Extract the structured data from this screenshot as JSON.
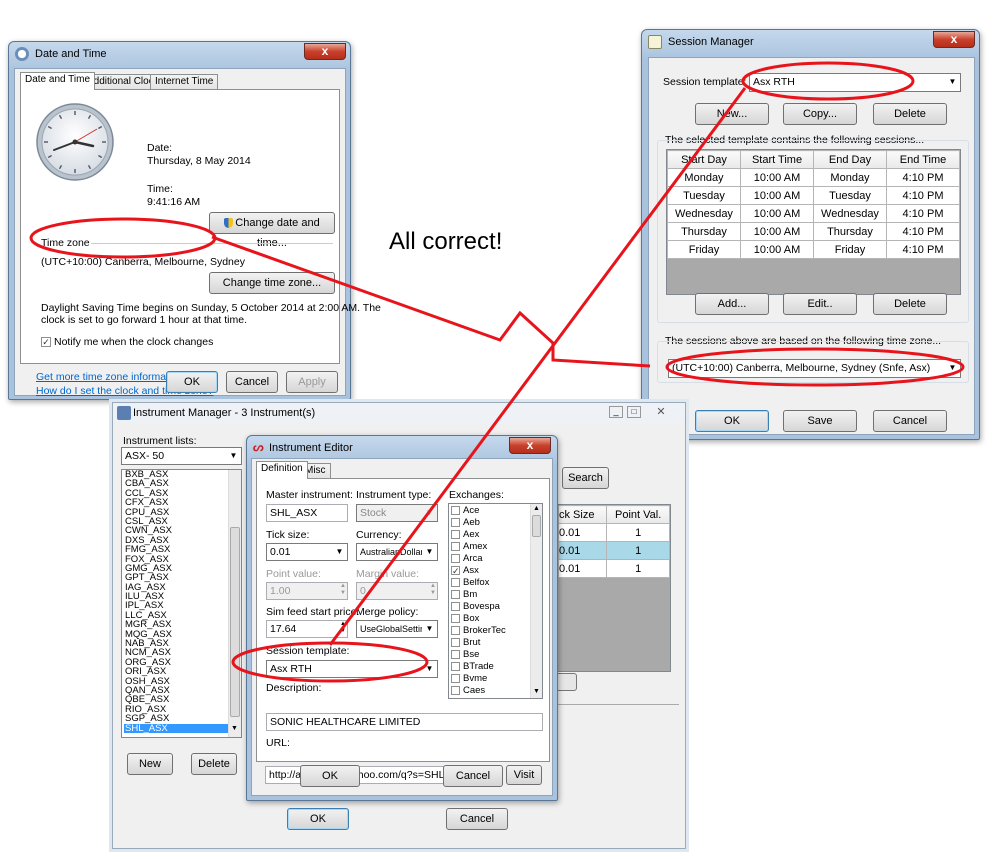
{
  "annotation": {
    "text": "All correct!"
  },
  "datetime": {
    "title": "Date and Time",
    "close": "x",
    "tabs": [
      "Date and Time",
      "Additional Clocks",
      "Internet Time"
    ],
    "date_label": "Date:",
    "date_value": "Thursday, 8 May 2014",
    "time_label": "Time:",
    "time_value": "9:41:16 AM",
    "change_dt_btn": "Change date and time...",
    "tz_label": "Time zone",
    "tz_value": "(UTC+10:00) Canberra, Melbourne, Sydney",
    "change_tz_btn": "Change time zone...",
    "dst_text_1": "Daylight Saving Time begins on Sunday, 5 October 2014 at 2:00 AM. The",
    "dst_text_2": "clock is set to go forward 1 hour at that time.",
    "notify_label": "Notify me when the clock changes",
    "link1": "Get more time zone information online",
    "link2": "How do I set the clock and time zone?",
    "ok": "OK",
    "cancel": "Cancel",
    "apply": "Apply"
  },
  "session": {
    "title": "Session Manager",
    "close": "x",
    "template_label": "Session template:",
    "template_value": "Asx RTH",
    "new_btn": "New...",
    "copy_btn": "Copy...",
    "delete_btn": "Delete",
    "sessions_caption": "The selected template contains the following sessions...",
    "columns": [
      "Start Day",
      "Start Time",
      "End Day",
      "End Time"
    ],
    "rows": [
      [
        "Monday",
        "10:00 AM",
        "Monday",
        "4:10 PM"
      ],
      [
        "Tuesday",
        "10:00 AM",
        "Tuesday",
        "4:10 PM"
      ],
      [
        "Wednesday",
        "10:00 AM",
        "Wednesday",
        "4:10 PM"
      ],
      [
        "Thursday",
        "10:00 AM",
        "Thursday",
        "4:10 PM"
      ],
      [
        "Friday",
        "10:00 AM",
        "Friday",
        "4:10 PM"
      ]
    ],
    "add_btn": "Add...",
    "edit_btn": "Edit..",
    "delete2_btn": "Delete",
    "tz_caption": "The sessions above are based on the following time zone...",
    "tz_value": "(UTC+10:00) Canberra, Melbourne, Sydney (Snfe, Asx)",
    "ok": "OK",
    "save": "Save",
    "cancel": "Cancel"
  },
  "instmgr": {
    "title": "Instrument Manager - 3 Instrument(s)",
    "lists_label": "Instrument lists:",
    "list_value": "ASX- 50",
    "symbols": [
      "BXB_ASX",
      "CBA_ASX",
      "CCL_ASX",
      "CFX_ASX",
      "CPU_ASX",
      "CSL_ASX",
      "CWN_ASX",
      "DXS_ASX",
      "FMG_ASX",
      "FOX_ASX",
      "GMG_ASX",
      "GPT_ASX",
      "IAG_ASX",
      "ILU_ASX",
      "IPL_ASX",
      "LLC_ASX",
      "MGR_ASX",
      "MQG_ASX",
      "NAB_ASX",
      "NCM_ASX",
      "ORG_ASX",
      "ORI_ASX",
      "OSH_ASX",
      "QAN_ASX",
      "QBE_ASX",
      "RIO_ASX",
      "SGP_ASX",
      "SHL_ASX"
    ],
    "selected": "SHL_ASX",
    "new_btn": "New",
    "delete_btn": "Delete",
    "search_btn": "Search",
    "grid_cols": [
      "ck Size",
      "Point Val."
    ],
    "grid_rows": [
      [
        "0.01",
        "1"
      ],
      [
        "0.01",
        "1"
      ],
      [
        "0.01",
        "1"
      ]
    ],
    "ok": "OK",
    "cancel": "Cancel"
  },
  "editor": {
    "title": "Instrument Editor",
    "close": "x",
    "tabs": [
      "Definition",
      "Misc"
    ],
    "master_label": "Master instrument:",
    "master_value": "SHL_ASX",
    "type_label": "Instrument type:",
    "type_value": "Stock",
    "tick_label": "Tick size:",
    "tick_value": "0.01",
    "currency_label": "Currency:",
    "currency_value": "AustralianDollar",
    "point_label": "Point value:",
    "point_value": "1.00",
    "margin_label": "Margin value:",
    "margin_value": "0",
    "sim_label": "Sim feed start price:",
    "sim_value": "17.64",
    "merge_label": "Merge policy:",
    "merge_value": "UseGlobalSettings",
    "session_label": "Session template:",
    "session_value": "Asx RTH",
    "exchanges_label": "Exchanges:",
    "exchanges": [
      "Ace",
      "Aeb",
      "Aex",
      "Amex",
      "Arca",
      "Asx",
      "Belfox",
      "Bm",
      "Bovespa",
      "Box",
      "BrokerTec",
      "Brut",
      "Bse",
      "BTrade",
      "Bvme",
      "Caes"
    ],
    "exchange_checked": "Asx",
    "desc_label": "Description:",
    "desc_value": "SONIC HEALTHCARE LIMITED",
    "url_label": "URL:",
    "url_value": "http://au.finance.yahoo.com/q?s=SHL.AX",
    "visit_btn": "Visit",
    "ok": "OK",
    "cancel": "Cancel"
  }
}
